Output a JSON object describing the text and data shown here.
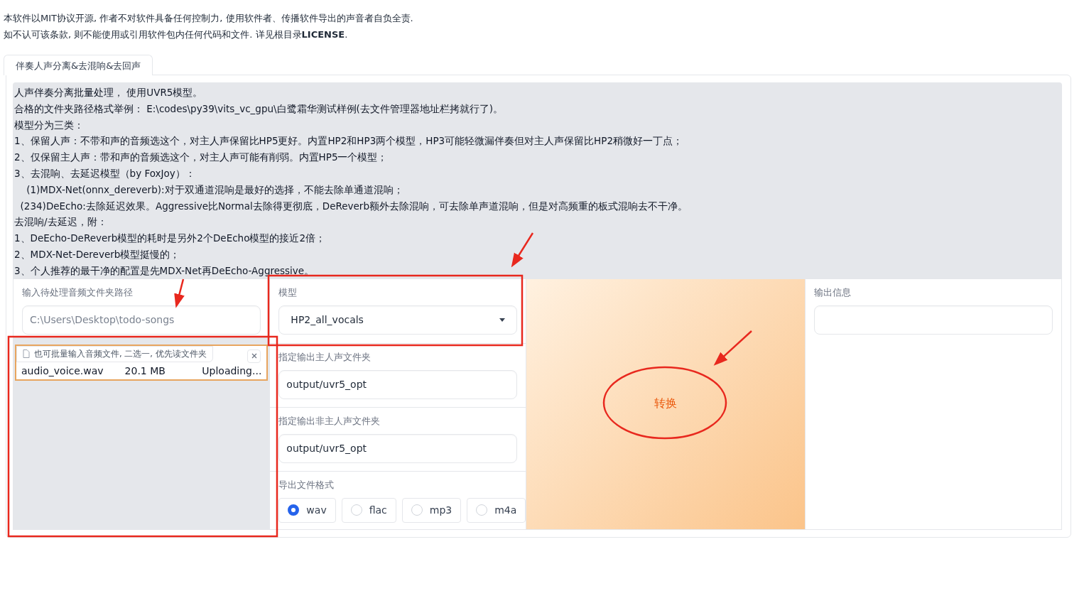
{
  "notice": [
    "本软件以MIT协议开源, 作者不对软件具备任何控制力, 使用软件者、传播软件导出的声音者自负全责.",
    "如不认可该条款, 则不能使用或引用软件包内任何代码和文件. 详见根目录**LICENSE**."
  ],
  "tabs": [
    {
      "label": "伴奏人声分离&去混响&去回声",
      "selected": true
    }
  ],
  "info_lines": [
    "人声伴奏分离批量处理， 使用UVR5模型。",
    "合格的文件夹路径格式举例： E:\\codes\\py39\\vits_vc_gpu\\白鹭霜华测试样例(去文件管理器地址栏拷就行了)。",
    "模型分为三类：",
    "1、保留人声：不带和声的音频选这个，对主人声保留比HP5更好。内置HP2和HP3两个模型，HP3可能轻微漏伴奏但对主人声保留比HP2稍微好一丁点；",
    "2、仅保留主人声：带和声的音频选这个，对主人声可能有削弱。内置HP5一个模型；",
    "3、去混响、去延迟模型（by FoxJoy）：",
    "    (1)MDX-Net(onnx_dereverb):对于双通道混响是最好的选择，不能去除单通道混响；",
    "  (234)DeEcho:去除延迟效果。Aggressive比Normal去除得更彻底，DeReverb额外去除混响，可去除单声道混响，但是对高频重的板式混响去不干净。",
    "去混响/去延迟，附：",
    "1、DeEcho-DeReverb模型的耗时是另外2个DeEcho模型的接近2倍；",
    "2、MDX-Net-Dereverb模型挺慢的；",
    "3、个人推荐的最干净的配置是先MDX-Net再DeEcho-Aggressive。"
  ],
  "input_folder": {
    "label": "输入待处理音频文件夹路径",
    "placeholder": "C:\\Users\\Desktop\\todo-songs"
  },
  "file_upload": {
    "label": "也可批量输入音频文件, 二选一, 优先读文件夹",
    "file_name": "audio_voice.wav",
    "file_size": "20.1 MB",
    "status": "Uploading..."
  },
  "model": {
    "label": "模型",
    "value": "HP2_all_vocals"
  },
  "vocal_folder": {
    "label": "指定输出主人声文件夹",
    "value": "output/uvr5_opt"
  },
  "instrument_folder": {
    "label": "指定输出非主人声文件夹",
    "value": "output/uvr5_opt"
  },
  "format": {
    "label": "导出文件格式",
    "options": [
      {
        "label": "wav",
        "selected": true
      },
      {
        "label": "flac",
        "selected": false
      },
      {
        "label": "mp3",
        "selected": false
      },
      {
        "label": "m4a",
        "selected": false
      }
    ]
  },
  "convert_button": "转换",
  "output_info": {
    "label": "输出信息"
  }
}
